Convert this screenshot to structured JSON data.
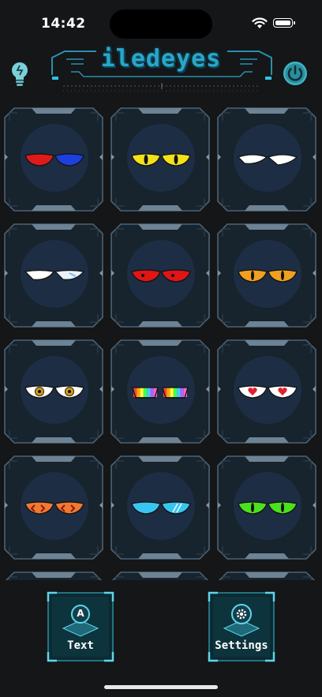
{
  "status_bar": {
    "time": "14:42"
  },
  "app": {
    "title": "iledeyes"
  },
  "eye_presets": [
    {
      "name": "red-blue"
    },
    {
      "name": "yellow-cat"
    },
    {
      "name": "white-sleepy"
    },
    {
      "name": "white-sleepy-left"
    },
    {
      "name": "red-angry"
    },
    {
      "name": "orange-cat"
    },
    {
      "name": "golden-rings"
    },
    {
      "name": "rainbow-stripes"
    },
    {
      "name": "hearts"
    },
    {
      "name": "orange-chevrons"
    },
    {
      "name": "cyan-shiny"
    },
    {
      "name": "green-cat"
    }
  ],
  "actions": {
    "text_label": "Text",
    "text_icon_letter": "A",
    "settings_label": "Settings"
  },
  "colors": {
    "accent": "#2aa6c7",
    "tile_border": "#4c6274",
    "face": "#1d2e44",
    "background": "#141617"
  }
}
